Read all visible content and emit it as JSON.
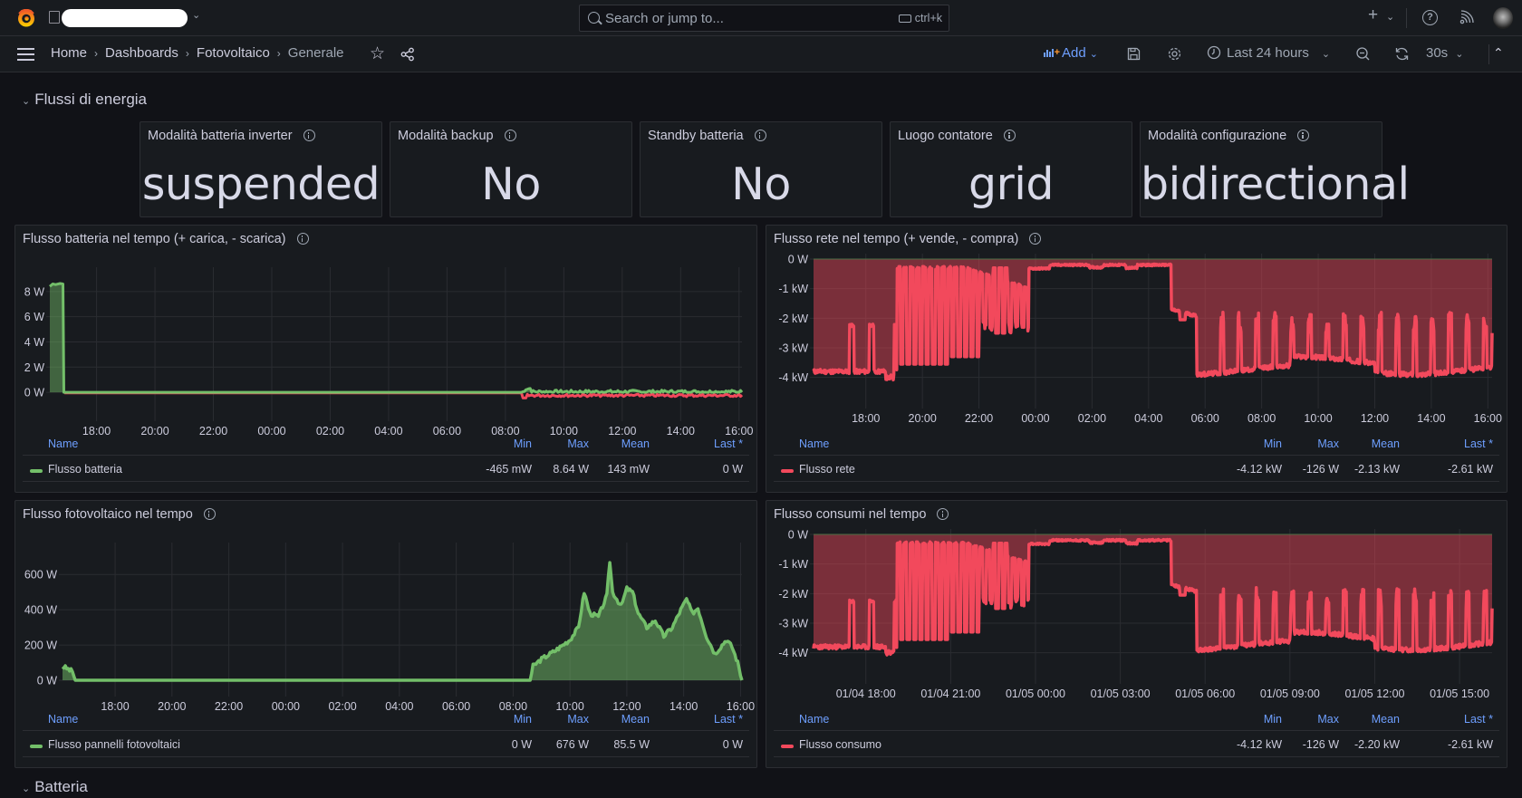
{
  "topbar": {
    "search_placeholder": "Search or jump to...",
    "search_shortcut": "ctrl+k",
    "new_button": "+",
    "icons": [
      "grafana-logo-icon",
      "organization-icon",
      "plus-icon",
      "help-icon",
      "news-rss-icon",
      "user-avatar"
    ]
  },
  "navbar": {
    "breadcrumb": [
      "Home",
      "Dashboards",
      "Fotovoltaico",
      "Generale"
    ],
    "add_label": "Add",
    "time_range": "Last 24 hours",
    "refresh_interval": "30s"
  },
  "rows": [
    {
      "title": "Flussi di energia"
    },
    {
      "title": "Batteria"
    }
  ],
  "stats": [
    {
      "title": "Modalità batteria inverter",
      "value": "suspended"
    },
    {
      "title": "Modalità backup",
      "value": "No"
    },
    {
      "title": "Standby batteria",
      "value": "No"
    },
    {
      "title": "Luogo contatore",
      "value": "grid"
    },
    {
      "title": "Modalità configurazione",
      "value": "bidirectional"
    }
  ],
  "legend_headers": {
    "name": "Name",
    "min": "Min",
    "max": "Max",
    "mean": "Mean",
    "last": "Last *"
  },
  "colors": {
    "green": "#73bf69",
    "red": "#f2495c"
  },
  "chart_data": [
    {
      "type": "line",
      "title": "Flusso batteria nel tempo (+ carica, - scarica)",
      "x_ticks": [
        "18:00",
        "20:00",
        "22:00",
        "00:00",
        "02:00",
        "04:00",
        "06:00",
        "08:00",
        "10:00",
        "12:00",
        "14:00",
        "16:00"
      ],
      "y_ticks": [
        "0 W",
        "2 W",
        "4 W",
        "6 W",
        "8 W"
      ],
      "ylim": [
        -1,
        9.5
      ],
      "x_range_hours": [
        16.4,
        40.1
      ],
      "legend": {
        "name": "Flusso batteria",
        "color": "#73bf69",
        "min": "-465 mW",
        "max": "8.64 W",
        "mean": "143 mW",
        "last": "0 W"
      },
      "series_points": [
        [
          16.4,
          8.5
        ],
        [
          16.8,
          8.7
        ],
        [
          16.9,
          0
        ],
        [
          32.6,
          0
        ],
        [
          32.8,
          -0.3
        ],
        [
          33,
          0.2
        ],
        [
          33.5,
          -0.1
        ],
        [
          34,
          -0.2
        ],
        [
          35,
          -0.1
        ],
        [
          36,
          -0.2
        ],
        [
          37,
          -0.15
        ],
        [
          38,
          -0.1
        ],
        [
          39,
          -0.05
        ],
        [
          40,
          0
        ]
      ]
    },
    {
      "type": "area",
      "title": "Flusso rete nel tempo (+ vende, - compra)",
      "x_ticks": [
        "18:00",
        "20:00",
        "22:00",
        "00:00",
        "02:00",
        "04:00",
        "06:00",
        "08:00",
        "10:00",
        "12:00",
        "14:00",
        "16:00"
      ],
      "y_ticks": [
        "-4 kW",
        "-3 kW",
        "-2 kW",
        "-1 kW",
        "0 W"
      ],
      "ylim": [
        -4.5,
        0
      ],
      "x_range_hours": [
        16.15,
        40.15
      ],
      "legend": {
        "name": "Flusso rete",
        "color": "#f2495c",
        "min": "-4.12 kW",
        "max": "-126 W",
        "mean": "-2.13 kW",
        "last": "-2.61 kW"
      }
    },
    {
      "type": "area",
      "title": "Flusso fotovoltaico nel tempo",
      "x_ticks": [
        "18:00",
        "20:00",
        "22:00",
        "00:00",
        "02:00",
        "04:00",
        "06:00",
        "08:00",
        "10:00",
        "12:00",
        "14:00",
        "16:00"
      ],
      "y_ticks": [
        "0 W",
        "200 W",
        "400 W",
        "600 W"
      ],
      "ylim": [
        0,
        750
      ],
      "x_range_hours": [
        16.15,
        40.05
      ],
      "legend": {
        "name": "Flusso pannelli fotovoltaici",
        "color": "#73bf69",
        "min": "0 W",
        "max": "676 W",
        "mean": "85.5 W",
        "last": "0 W"
      },
      "series_points": [
        [
          16.15,
          80
        ],
        [
          16.5,
          50
        ],
        [
          16.6,
          0
        ],
        [
          32.6,
          0
        ],
        [
          32.7,
          80
        ],
        [
          33,
          120
        ],
        [
          33.5,
          170
        ],
        [
          34,
          230
        ],
        [
          34.3,
          300
        ],
        [
          34.5,
          500
        ],
        [
          34.7,
          380
        ],
        [
          35,
          360
        ],
        [
          35.3,
          480
        ],
        [
          35.4,
          676
        ],
        [
          35.5,
          500
        ],
        [
          35.8,
          420
        ],
        [
          36,
          520
        ],
        [
          36.2,
          500
        ],
        [
          36.4,
          380
        ],
        [
          36.7,
          300
        ],
        [
          37,
          340
        ],
        [
          37.3,
          250
        ],
        [
          37.6,
          300
        ],
        [
          37.9,
          400
        ],
        [
          38.1,
          460
        ],
        [
          38.3,
          380
        ],
        [
          38.5,
          410
        ],
        [
          38.8,
          250
        ],
        [
          39.1,
          150
        ],
        [
          39.5,
          230
        ],
        [
          39.7,
          190
        ],
        [
          39.9,
          100
        ],
        [
          40.05,
          0
        ]
      ]
    },
    {
      "type": "area",
      "title": "Flusso consumi nel tempo",
      "x_ticks": [
        "01/04 18:00",
        "01/04 21:00",
        "01/05 00:00",
        "01/05 03:00",
        "01/05 06:00",
        "01/05 09:00",
        "01/05 12:00",
        "01/05 15:00"
      ],
      "y_ticks": [
        "-4 kW",
        "-3 kW",
        "-2 kW",
        "-1 kW",
        "0 W"
      ],
      "ylim": [
        -4.5,
        0
      ],
      "x_range_hours": [
        16.15,
        40.15
      ],
      "legend": {
        "name": "Flusso consumo",
        "color": "#f2495c",
        "min": "-4.12 kW",
        "max": "-126 W",
        "mean": "-2.20 kW",
        "last": "-2.61 kW"
      }
    }
  ]
}
